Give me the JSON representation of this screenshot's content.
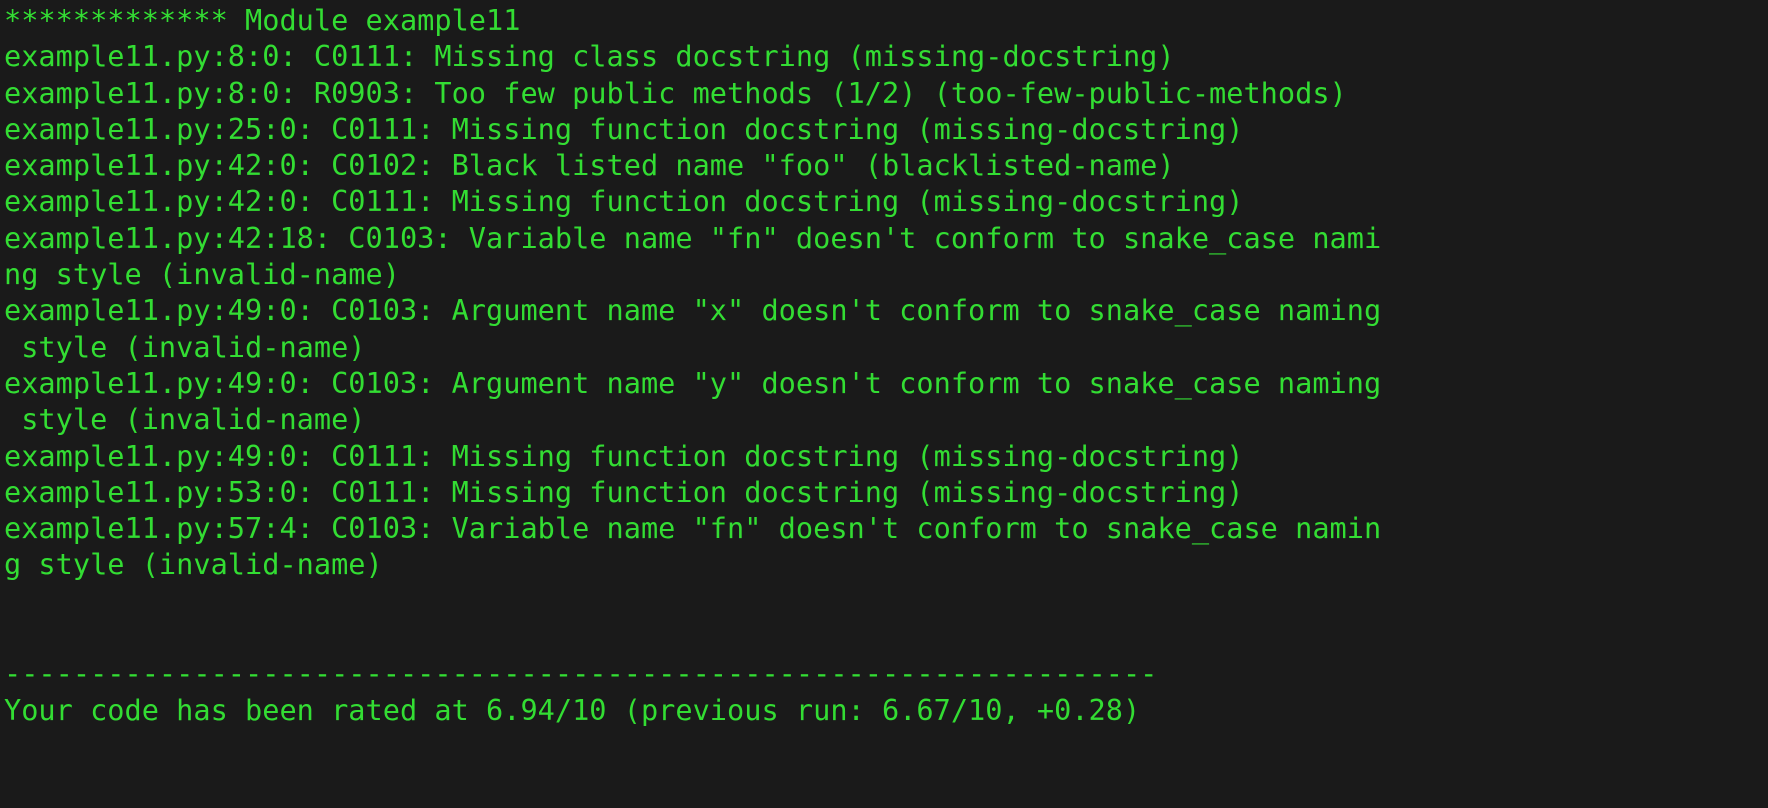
{
  "terminal": {
    "foreground_color": "#33dd33",
    "background_color": "#1a1a1a",
    "columns": 80,
    "module_header": "************* Module example11",
    "lines": [
      "************* Module example11",
      "example11.py:8:0: C0111: Missing class docstring (missing-docstring)",
      "example11.py:8:0: R0903: Too few public methods (1/2) (too-few-public-methods)",
      "example11.py:25:0: C0111: Missing function docstring (missing-docstring)",
      "example11.py:42:0: C0102: Black listed name \"foo\" (blacklisted-name)",
      "example11.py:42:0: C0111: Missing function docstring (missing-docstring)",
      "example11.py:42:18: C0103: Variable name \"fn\" doesn't conform to snake_case nami",
      "ng style (invalid-name)",
      "example11.py:49:0: C0103: Argument name \"x\" doesn't conform to snake_case naming",
      " style (invalid-name)",
      "example11.py:49:0: C0103: Argument name \"y\" doesn't conform to snake_case naming",
      " style (invalid-name)",
      "example11.py:49:0: C0111: Missing function docstring (missing-docstring)",
      "example11.py:53:0: C0111: Missing function docstring (missing-docstring)",
      "example11.py:57:4: C0103: Variable name \"fn\" doesn't conform to snake_case namin",
      "g style (invalid-name)",
      "",
      "",
      "-------------------------------------------------------------------",
      "Your code has been rated at 6.94/10 (previous run: 6.67/10, +0.28)"
    ],
    "separator": "-------------------------------------------------------------------",
    "rating_line": "Your code has been rated at 6.94/10 (previous run: 6.67/10, +0.28)",
    "rating": {
      "current_score": "6.94/10",
      "previous_score": "6.67/10",
      "delta": "+0.28"
    },
    "messages": [
      {
        "file": "example11.py",
        "line": "8",
        "column": "0",
        "code": "C0111",
        "text": "Missing class docstring",
        "symbol": "missing-docstring"
      },
      {
        "file": "example11.py",
        "line": "8",
        "column": "0",
        "code": "R0903",
        "text": "Too few public methods (1/2)",
        "symbol": "too-few-public-methods"
      },
      {
        "file": "example11.py",
        "line": "25",
        "column": "0",
        "code": "C0111",
        "text": "Missing function docstring",
        "symbol": "missing-docstring"
      },
      {
        "file": "example11.py",
        "line": "42",
        "column": "0",
        "code": "C0102",
        "text": "Black listed name \"foo\"",
        "symbol": "blacklisted-name"
      },
      {
        "file": "example11.py",
        "line": "42",
        "column": "0",
        "code": "C0111",
        "text": "Missing function docstring",
        "symbol": "missing-docstring"
      },
      {
        "file": "example11.py",
        "line": "42",
        "column": "18",
        "code": "C0103",
        "text": "Variable name \"fn\" doesn't conform to snake_case naming style",
        "symbol": "invalid-name"
      },
      {
        "file": "example11.py",
        "line": "49",
        "column": "0",
        "code": "C0103",
        "text": "Argument name \"x\" doesn't conform to snake_case naming style",
        "symbol": "invalid-name"
      },
      {
        "file": "example11.py",
        "line": "49",
        "column": "0",
        "code": "C0103",
        "text": "Argument name \"y\" doesn't conform to snake_case naming style",
        "symbol": "invalid-name"
      },
      {
        "file": "example11.py",
        "line": "49",
        "column": "0",
        "code": "C0111",
        "text": "Missing function docstring",
        "symbol": "missing-docstring"
      },
      {
        "file": "example11.py",
        "line": "53",
        "column": "0",
        "code": "C0111",
        "text": "Missing function docstring",
        "symbol": "missing-docstring"
      },
      {
        "file": "example11.py",
        "line": "57",
        "column": "4",
        "code": "C0103",
        "text": "Variable name \"fn\" doesn't conform to snake_case naming style",
        "symbol": "invalid-name"
      }
    ]
  }
}
